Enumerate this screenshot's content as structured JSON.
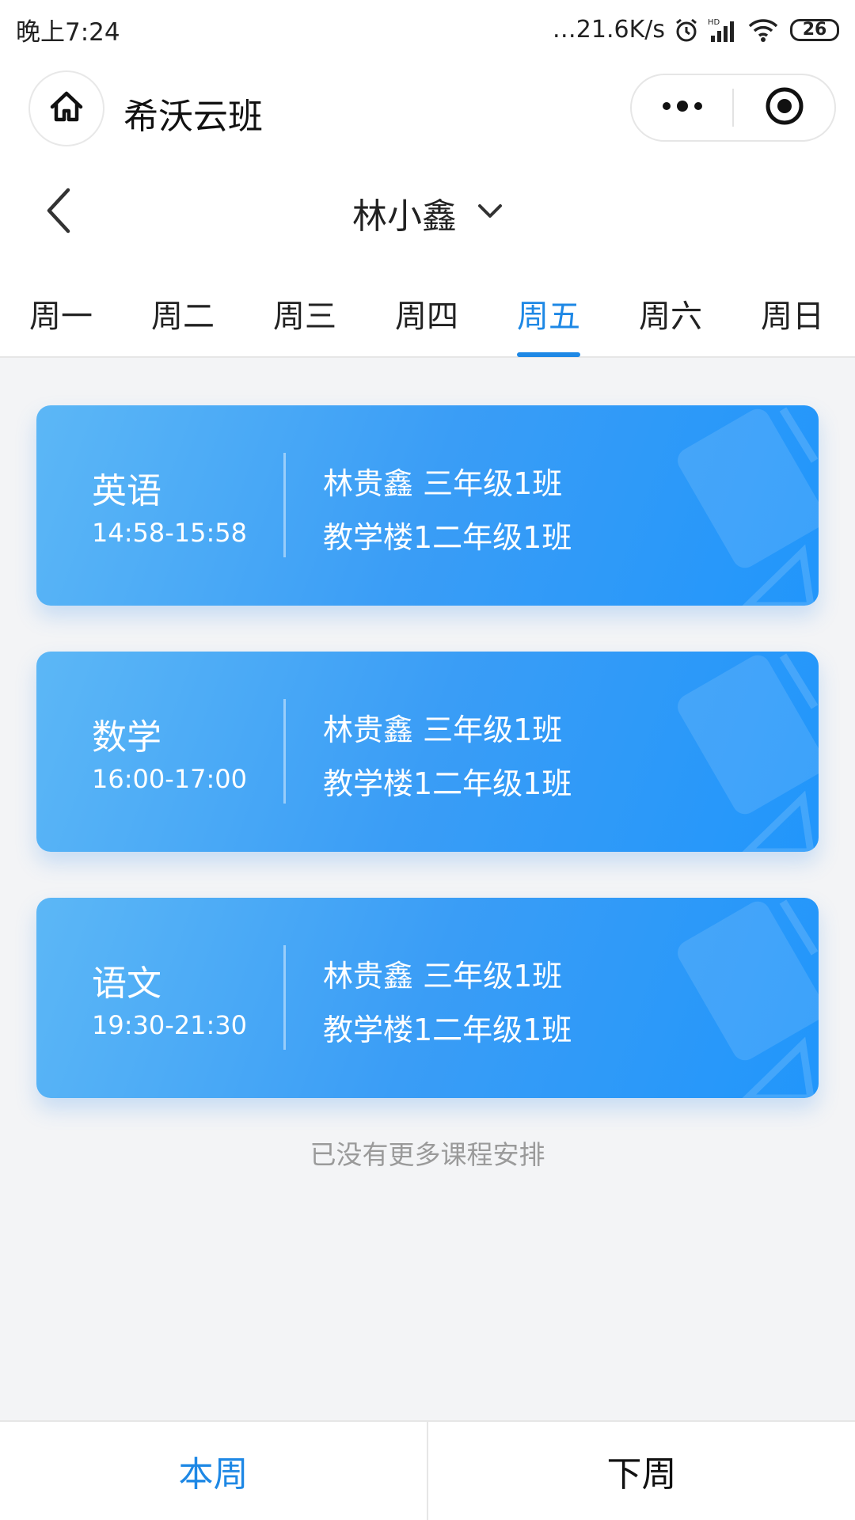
{
  "status_bar": {
    "time": "晚上7:24",
    "network_speed": "…21.6K/s",
    "battery": "26"
  },
  "nav": {
    "app_title": "希沃云班"
  },
  "header": {
    "student_name": "林小鑫"
  },
  "tabs": [
    {
      "label": "周一",
      "active": false
    },
    {
      "label": "周二",
      "active": false
    },
    {
      "label": "周三",
      "active": false
    },
    {
      "label": "周四",
      "active": false
    },
    {
      "label": "周五",
      "active": true
    },
    {
      "label": "周六",
      "active": false
    },
    {
      "label": "周日",
      "active": false
    }
  ],
  "courses": [
    {
      "name": "英语",
      "time": "14:58-15:58",
      "teacher_class": "林贵鑫 三年级1班",
      "location": "教学楼1二年级1班"
    },
    {
      "name": "数学",
      "time": "16:00-17:00",
      "teacher_class": "林贵鑫 三年级1班",
      "location": "教学楼1二年级1班"
    },
    {
      "name": "语文",
      "time": "19:30-21:30",
      "teacher_class": "林贵鑫 三年级1班",
      "location": "教学楼1二年级1班"
    }
  ],
  "footer_note": "已没有更多课程安排",
  "bottom": {
    "this_week": "本周",
    "next_week": "下周"
  },
  "colors": {
    "accent": "#1e88e5",
    "card_gradient_start": "#5cb7f6",
    "card_gradient_end": "#2196fb"
  }
}
